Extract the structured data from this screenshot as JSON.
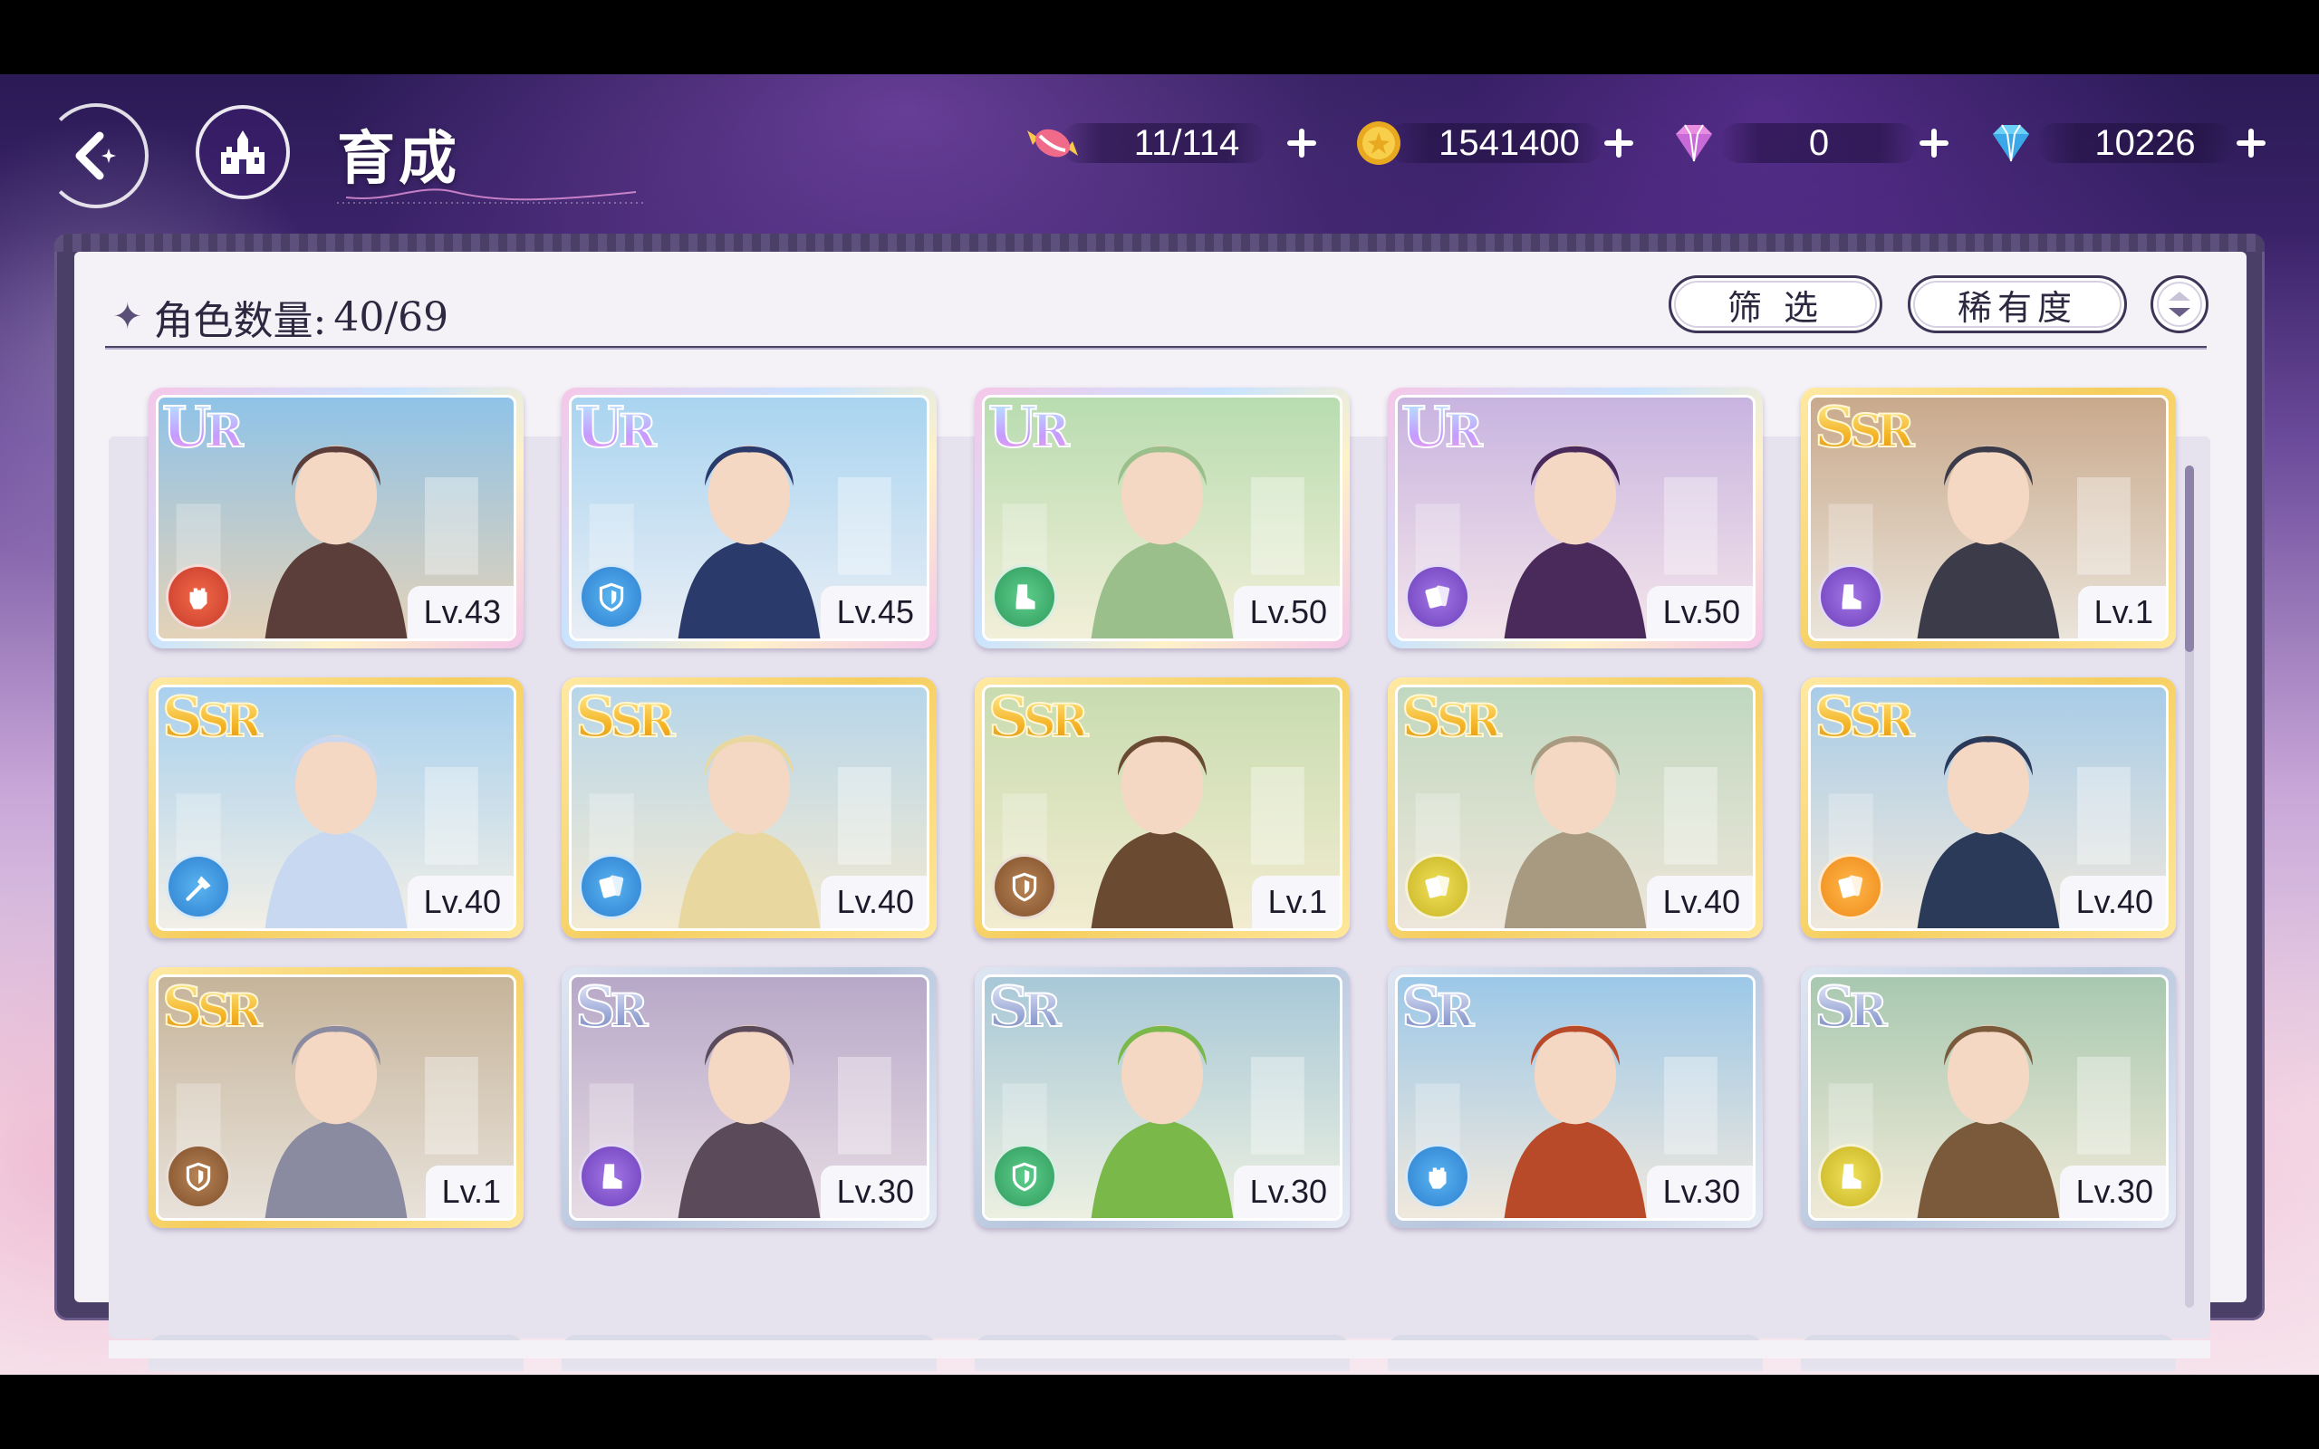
{
  "header": {
    "title": "育成",
    "back_icon": "back-arrow-icon",
    "home_icon": "castle-icon"
  },
  "resources": [
    {
      "name": "candy",
      "icon": "candy-icon",
      "value": "11/114"
    },
    {
      "name": "gold",
      "icon": "gold-coin-icon",
      "value": "1541400"
    },
    {
      "name": "pink-gem",
      "icon": "pink-diamond-icon",
      "value": "0"
    },
    {
      "name": "blue-gem",
      "icon": "blue-diamond-icon",
      "value": "10226"
    }
  ],
  "panel": {
    "count_label": "角色数量:",
    "count_value": "40/69",
    "filter_button": "筛 选",
    "rarity_button": "稀有度",
    "sort_icon": "sort-toggle-icon"
  },
  "colors": {
    "ur": "#c59bff",
    "ssr": "#f4b324",
    "sr": "#9aa8d6",
    "panel_border": "#4a3f66"
  },
  "characters": [
    {
      "rarity": "UR",
      "level": "Lv.43",
      "class_icon": "fist-icon",
      "class_color": "red"
    },
    {
      "rarity": "UR",
      "level": "Lv.45",
      "class_icon": "shield-icon",
      "class_color": "blue"
    },
    {
      "rarity": "UR",
      "level": "Lv.50",
      "class_icon": "boot-icon",
      "class_color": "green"
    },
    {
      "rarity": "UR",
      "level": "Lv.50",
      "class_icon": "cards-icon",
      "class_color": "purple"
    },
    {
      "rarity": "SSR",
      "level": "Lv.1",
      "class_icon": "boot-icon",
      "class_color": "purple"
    },
    {
      "rarity": "SSR",
      "level": "Lv.40",
      "class_icon": "staff-icon",
      "class_color": "blue"
    },
    {
      "rarity": "SSR",
      "level": "Lv.40",
      "class_icon": "cards-icon",
      "class_color": "blue"
    },
    {
      "rarity": "SSR",
      "level": "Lv.1",
      "class_icon": "shield-icon",
      "class_color": "brown"
    },
    {
      "rarity": "SSR",
      "level": "Lv.40",
      "class_icon": "cards-icon",
      "class_color": "yellow"
    },
    {
      "rarity": "SSR",
      "level": "Lv.40",
      "class_icon": "cards-icon",
      "class_color": "orange"
    },
    {
      "rarity": "SSR",
      "level": "Lv.1",
      "class_icon": "shield-icon",
      "class_color": "brown"
    },
    {
      "rarity": "SR",
      "level": "Lv.30",
      "class_icon": "boot-icon",
      "class_color": "purple"
    },
    {
      "rarity": "SR",
      "level": "Lv.30",
      "class_icon": "shield-icon",
      "class_color": "green"
    },
    {
      "rarity": "SR",
      "level": "Lv.30",
      "class_icon": "fist-icon",
      "class_color": "blue"
    },
    {
      "rarity": "SR",
      "level": "Lv.30",
      "class_icon": "boot-icon",
      "class_color": "yellow"
    }
  ]
}
